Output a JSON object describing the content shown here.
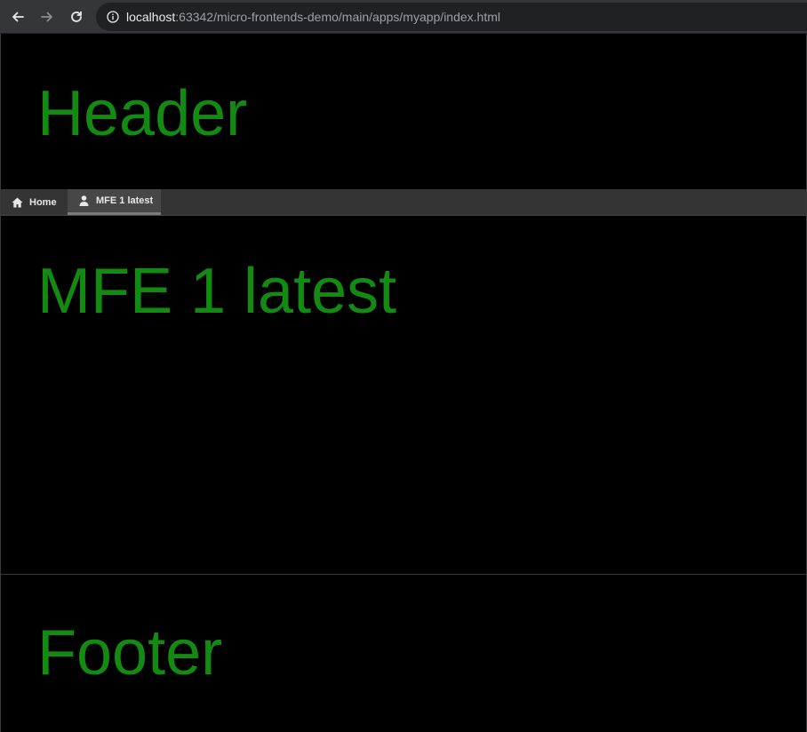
{
  "browser": {
    "url_host": "localhost",
    "url_rest": ":63342/micro-frontends-demo/main/apps/myapp/index.html"
  },
  "page": {
    "header_title": "Header",
    "nav": {
      "items": [
        {
          "label": "Home",
          "icon": "home-icon",
          "active": false
        },
        {
          "label": "MFE 1 latest",
          "icon": "user-icon",
          "active": true
        }
      ]
    },
    "content_title": "MFE 1 latest",
    "footer_title": "Footer"
  },
  "colors": {
    "title_green": "#138a12",
    "background": "#000000",
    "navbar": "#343434"
  }
}
